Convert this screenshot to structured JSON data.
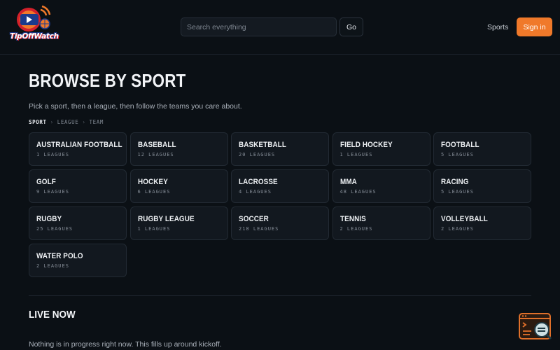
{
  "header": {
    "logo_text": "TipOffWatch",
    "search_placeholder": "Search everything",
    "go_label": "Go",
    "nav_sports": "Sports",
    "signin_label": "Sign in"
  },
  "page": {
    "title": "BROWSE BY SPORT",
    "subtitle": "Pick a sport, then a league, then follow the teams you care about.",
    "breadcrumb": [
      "SPORT",
      "LEAGUE",
      "TEAM"
    ],
    "breadcrumb_sep": "›"
  },
  "sports": [
    {
      "name": "AUSTRALIAN FOOTBALL",
      "count": "1 LEAGUES"
    },
    {
      "name": "BASEBALL",
      "count": "12 LEAGUES"
    },
    {
      "name": "BASKETBALL",
      "count": "20 LEAGUES"
    },
    {
      "name": "FIELD HOCKEY",
      "count": "1 LEAGUES"
    },
    {
      "name": "FOOTBALL",
      "count": "5 LEAGUES"
    },
    {
      "name": "GOLF",
      "count": "9 LEAGUES"
    },
    {
      "name": "HOCKEY",
      "count": "6 LEAGUES"
    },
    {
      "name": "LACROSSE",
      "count": "4 LEAGUES"
    },
    {
      "name": "MMA",
      "count": "48 LEAGUES"
    },
    {
      "name": "RACING",
      "count": "5 LEAGUES"
    },
    {
      "name": "RUGBY",
      "count": "25 LEAGUES"
    },
    {
      "name": "RUGBY LEAGUE",
      "count": "1 LEAGUES"
    },
    {
      "name": "SOCCER",
      "count": "218 LEAGUES"
    },
    {
      "name": "TENNIS",
      "count": "2 LEAGUES"
    },
    {
      "name": "VOLLEYBALL",
      "count": "2 LEAGUES"
    },
    {
      "name": "WATER POLO",
      "count": "2 LEAGUES"
    }
  ],
  "live": {
    "title": "LIVE NOW",
    "empty_message": "Nothing is in progress right now. This fills up around kickoff."
  },
  "colors": {
    "background": "#0b1015",
    "card": "#12181f",
    "accent": "#f0792a"
  },
  "icons": {
    "logo": "tipoffwatch-logo",
    "widget": "feedback-widget-icon"
  }
}
